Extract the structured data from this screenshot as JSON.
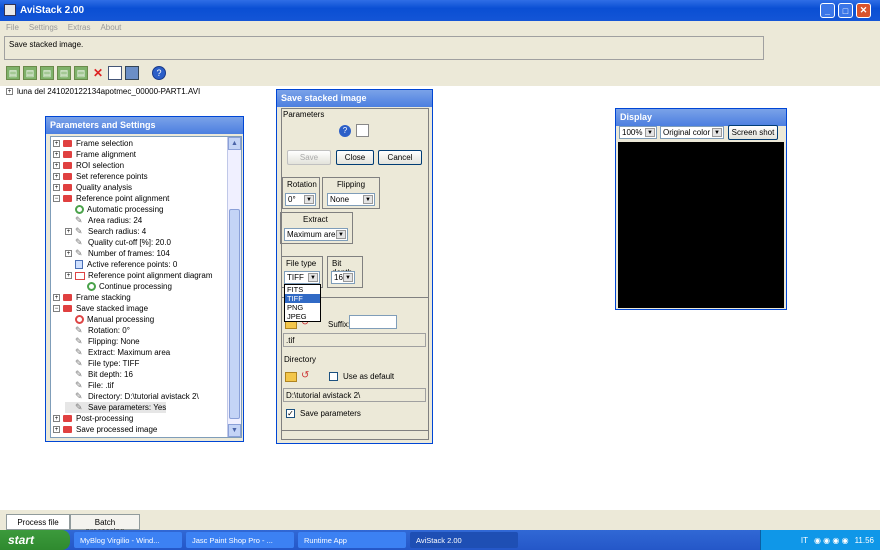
{
  "window": {
    "title": "AviStack 2.00",
    "min": "_",
    "max": "□",
    "close": "✕"
  },
  "menu": [
    "File",
    "Settings",
    "Extras",
    "About"
  ],
  "status_text": "Save stacked image.",
  "file_node": "luna del 241020122134apotmec_00000-PART1.AVI",
  "params_panel": {
    "title": "Parameters and Settings",
    "items": [
      {
        "label": "Frame selection"
      },
      {
        "label": "Frame alignment"
      },
      {
        "label": "ROI selection"
      },
      {
        "label": "Set reference points"
      },
      {
        "label": "Quality analysis"
      },
      {
        "label": "Reference point alignment"
      },
      {
        "label": "Automatic processing"
      },
      {
        "label": "Area radius: 24"
      },
      {
        "label": "Search radius: 4"
      },
      {
        "label": "Quality cut-off [%]: 20.0"
      },
      {
        "label": "Number of frames: 104"
      },
      {
        "label": "Active reference points: 0"
      },
      {
        "label": "Reference point alignment diagram"
      },
      {
        "label": "Continue processing"
      },
      {
        "label": "Frame stacking"
      },
      {
        "label": "Save stacked image"
      },
      {
        "label": "Manual processing"
      },
      {
        "label": "Rotation: 0°"
      },
      {
        "label": "Flipping: None"
      },
      {
        "label": "Extract: Maximum area"
      },
      {
        "label": "File type: TIFF"
      },
      {
        "label": "Bit depth: 16"
      },
      {
        "label": "File: .tif"
      },
      {
        "label": "Directory: D:\\tutorial avistack 2\\"
      },
      {
        "label": "Save parameters: Yes"
      },
      {
        "label": "Post-processing"
      },
      {
        "label": "Save processed image"
      }
    ]
  },
  "save_dialog": {
    "title": "Save stacked image",
    "section": "Parameters",
    "buttons": {
      "save": "Save",
      "close": "Close",
      "cancel": "Cancel"
    },
    "rotation": {
      "label": "Rotation",
      "value": "0°"
    },
    "flipping": {
      "label": "Flipping",
      "value": "None"
    },
    "extract": {
      "label": "Extract",
      "value": "Maximum area"
    },
    "file_type": {
      "label": "File type",
      "value": "TIFF",
      "options": [
        "FITS",
        "TIFF",
        "PNG",
        "JPEG"
      ]
    },
    "bit_depth": {
      "label": "Bit depth",
      "value": "16"
    },
    "suffix_label": "Suffix:",
    "suffix_value": "",
    "file_ext": ".tif",
    "directory_label": "Directory",
    "use_default": "Use as default",
    "directory_path": "D:\\tutorial avistack 2\\",
    "save_params": "Save parameters"
  },
  "display": {
    "title": "Display",
    "zoom": "100%",
    "color": "Original color",
    "shot": "Screen shot"
  },
  "tabs": [
    "Process file",
    "Batch processing"
  ],
  "taskbar": {
    "start": "start",
    "tasks": [
      "MyBlog Virgilio - Wind...",
      "Jasc Paint Shop Pro - ...",
      "Runtime App",
      "AviStack 2.00"
    ],
    "lang": "IT",
    "time": "11.56"
  }
}
